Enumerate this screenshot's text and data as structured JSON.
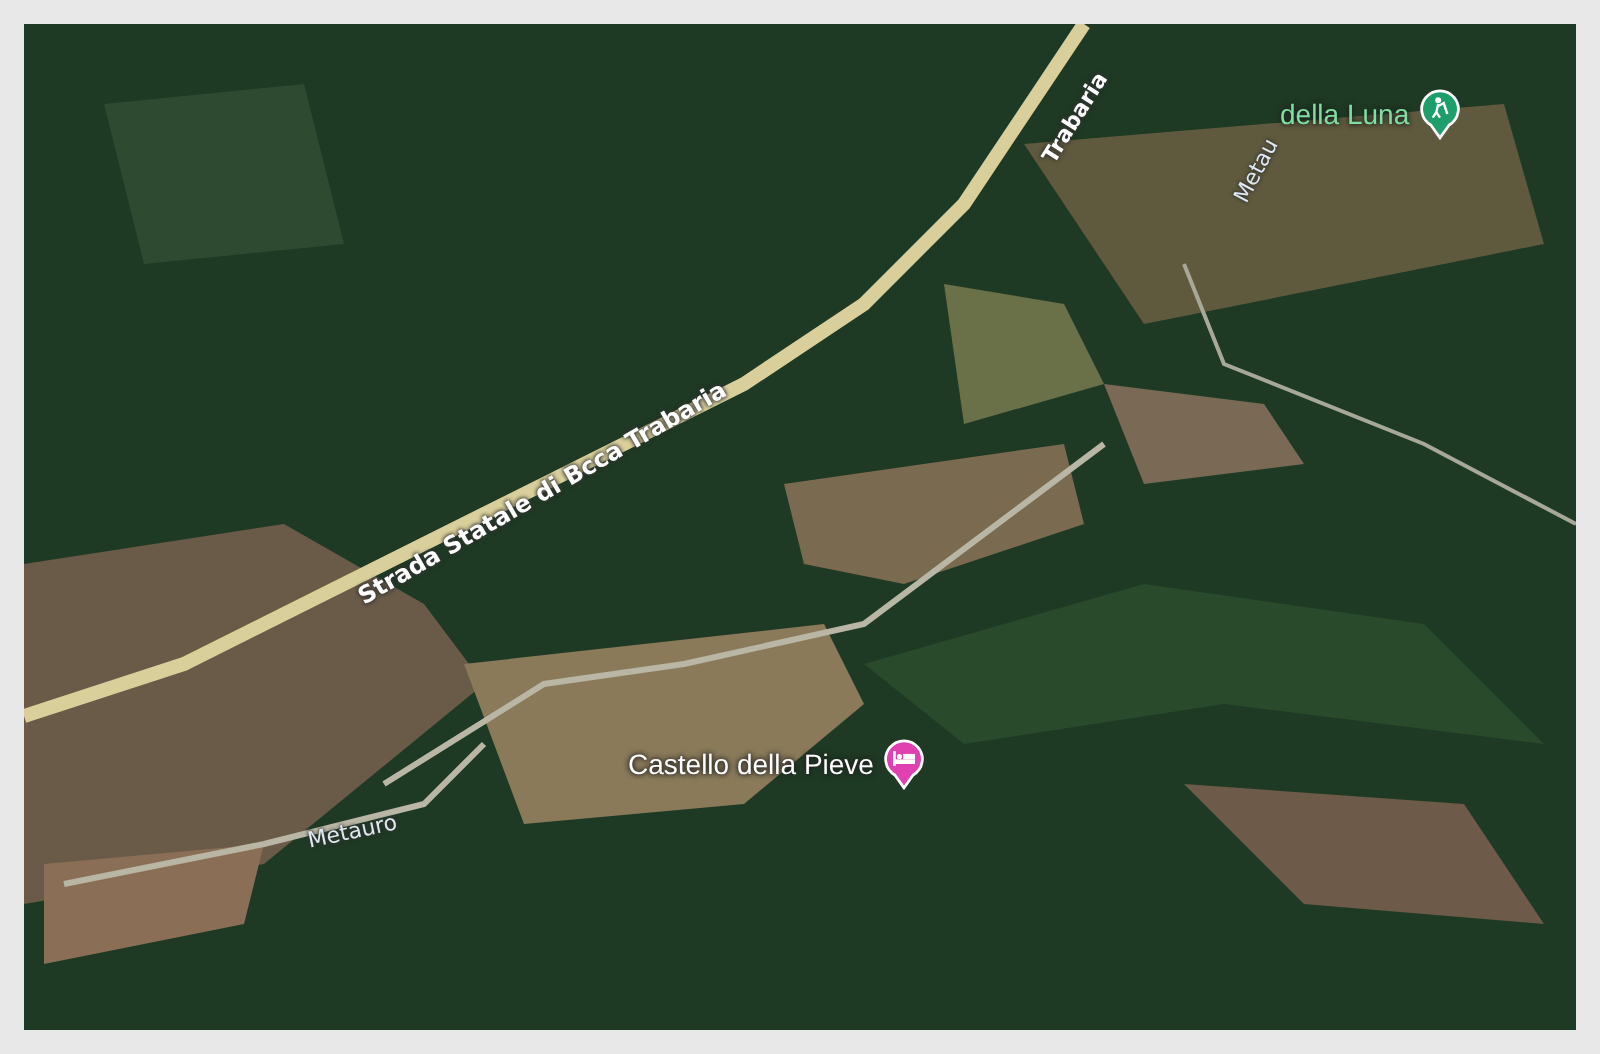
{
  "map": {
    "road_labels": [
      {
        "kind": "road",
        "text": "Strada Statale di Bcca Trabaria"
      },
      {
        "kind": "road",
        "text": "Trabaria"
      },
      {
        "kind": "river",
        "text": "Metau"
      },
      {
        "kind": "river",
        "text": "Metauro"
      }
    ],
    "places": [
      {
        "kind": "golf",
        "text": "della Luna",
        "color": "#1e9e6a"
      },
      {
        "kind": "hotel",
        "text": "Castello della Pieve",
        "color": "#e040b0"
      }
    ]
  }
}
